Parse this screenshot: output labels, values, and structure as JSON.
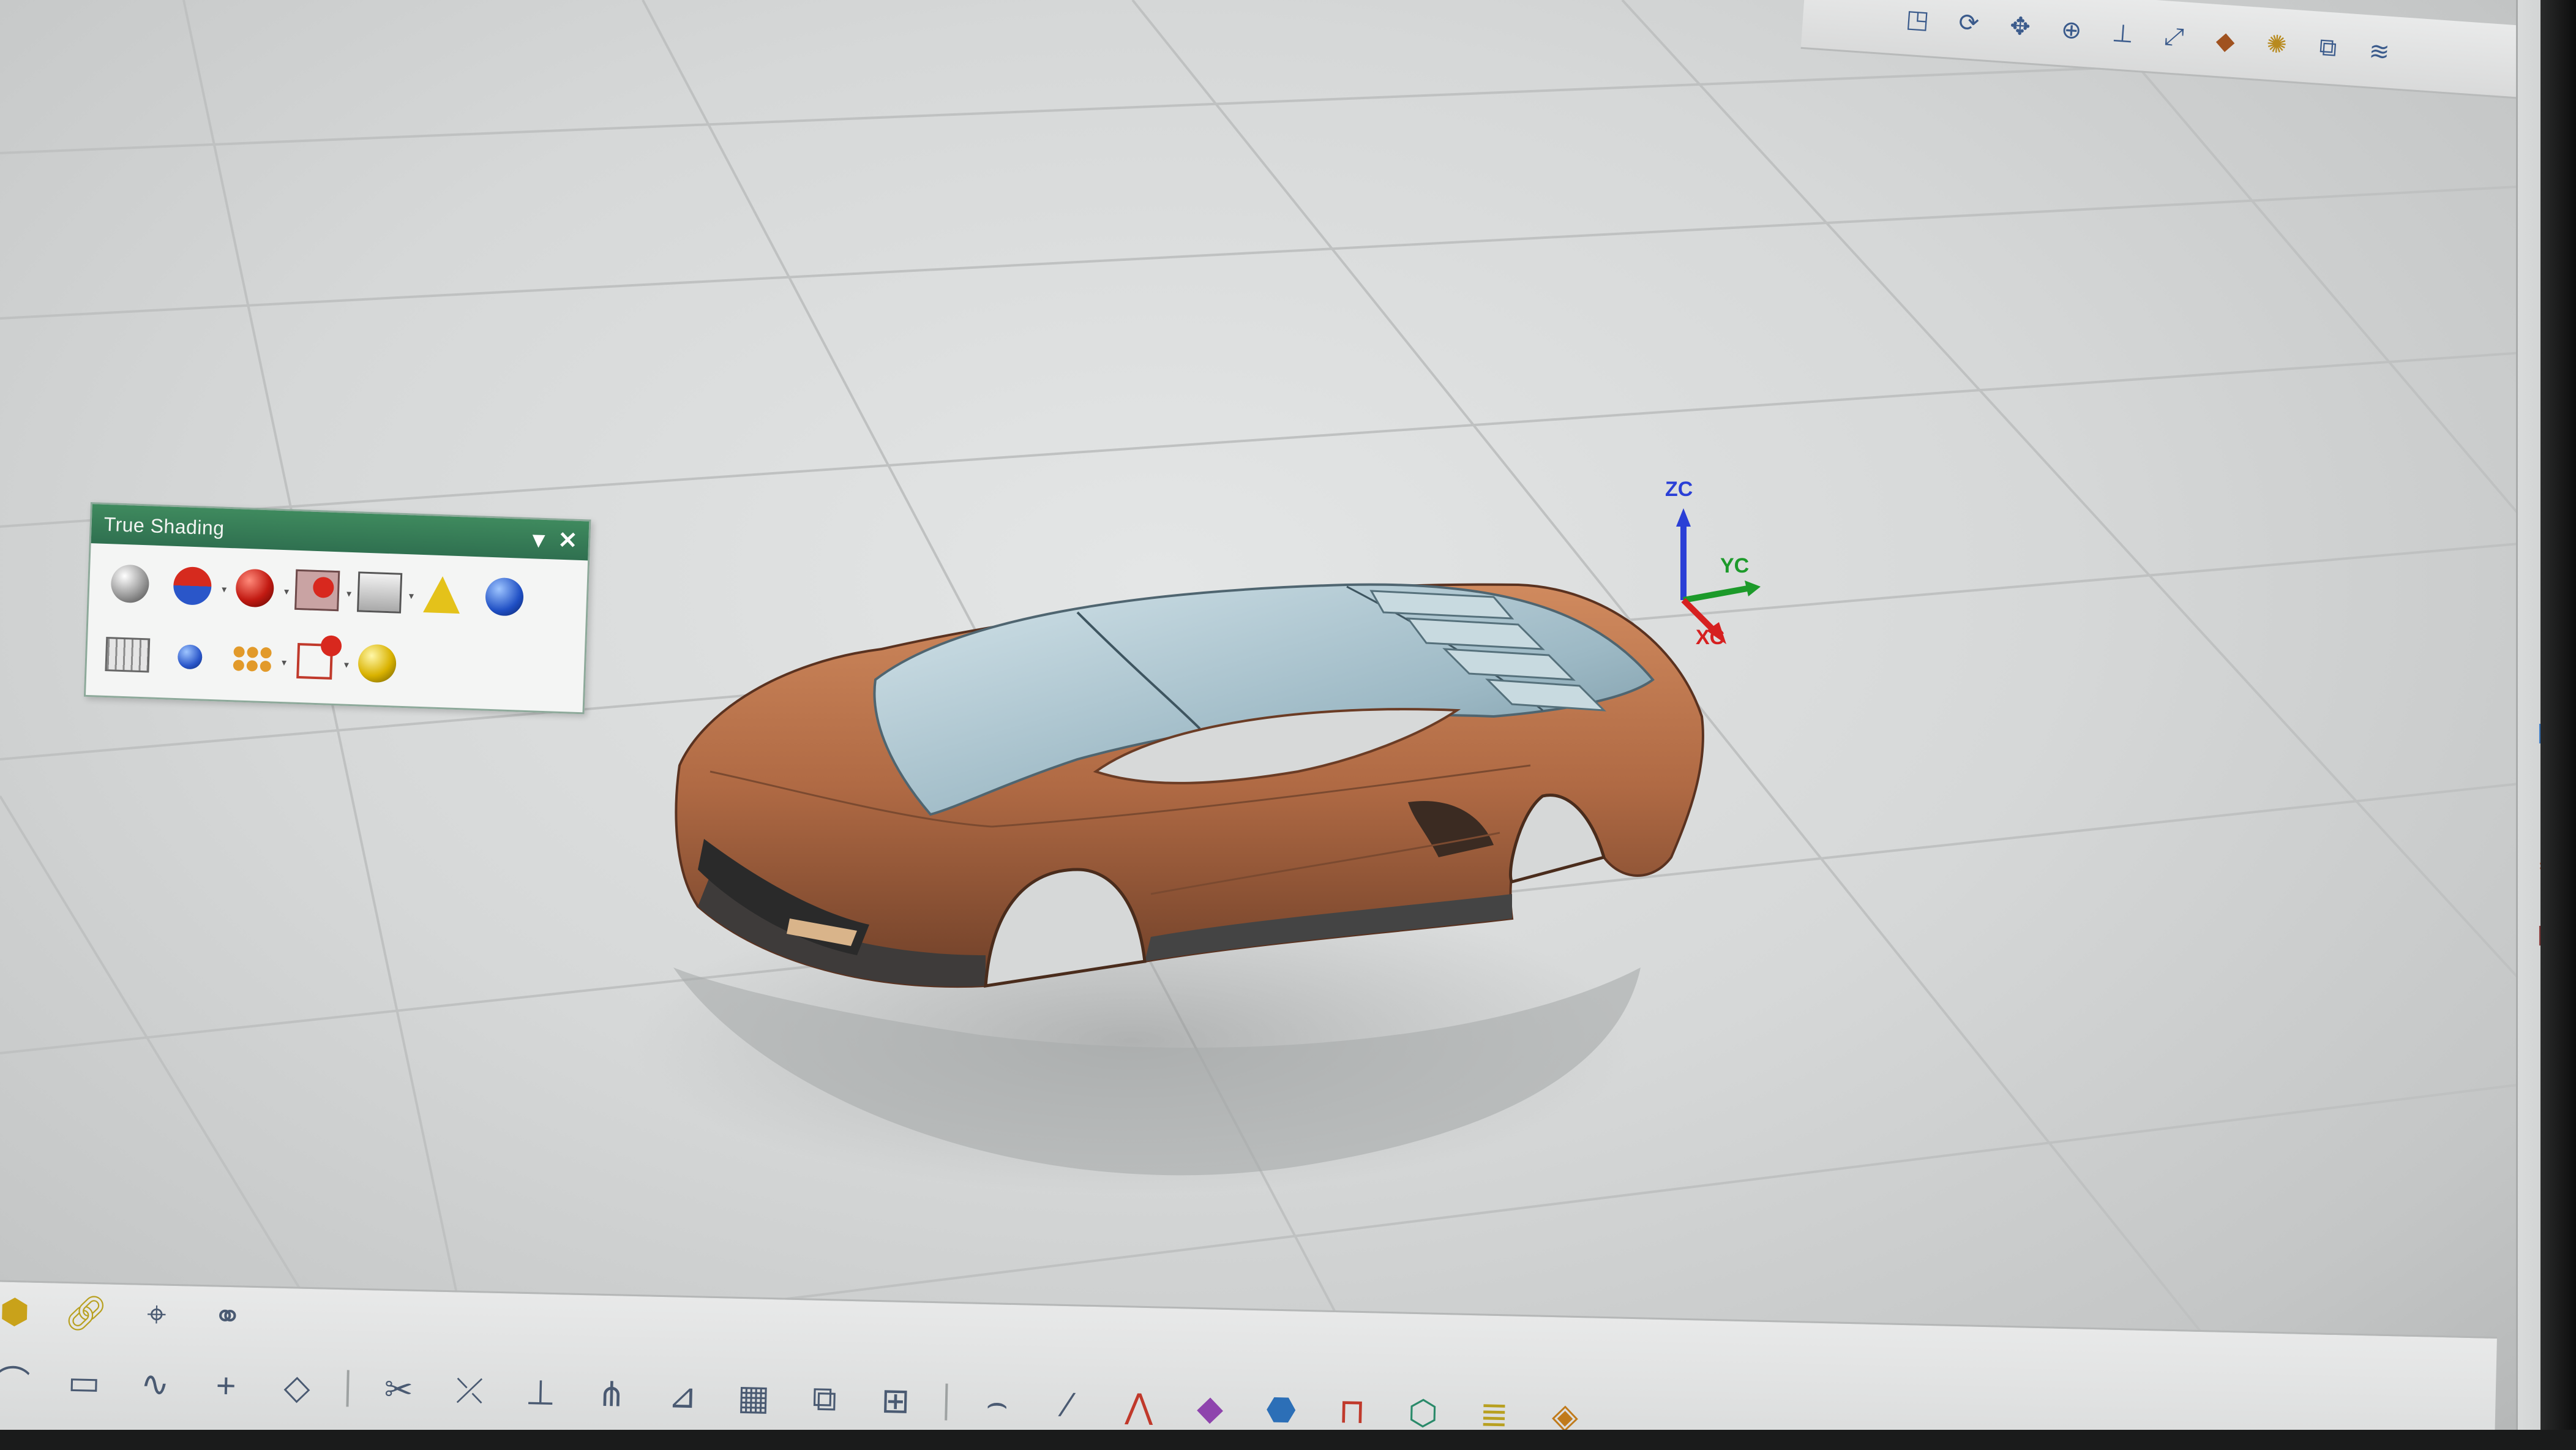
{
  "palette": {
    "title": "True Shading",
    "menu_glyph": "▾",
    "close_glyph": "✕",
    "row1": [
      "shaded-sphere-icon",
      "red-blue-sphere-icon",
      "red-sphere-icon",
      "texture-icon",
      "background-icon",
      "light-icon",
      "blue-sphere-icon"
    ],
    "row2": [
      "grid-plane-icon",
      "figure-icon",
      "cluster-icon",
      "cube-sphere-icon",
      "globe-icon"
    ]
  },
  "triad": {
    "z": "ZC",
    "y": "YC",
    "x": "XC"
  },
  "colors": {
    "palette_title": "#2f7050",
    "car_body": "#b8714a",
    "car_glass": "#a9c4cf",
    "axis_x": "#d62020",
    "axis_y": "#1c9a2a",
    "axis_z": "#2a3fd6"
  },
  "top_toolbar_icons": [
    "view-icon",
    "rotate-icon",
    "pan-icon",
    "zoom-icon",
    "wcs-icon",
    "fit-icon",
    "render-icon",
    "light-icon",
    "style-icon",
    "spring-icon"
  ],
  "bottom_toolbar_row1": [
    "feature-icon",
    "sketch-icon",
    "dimension-icon",
    "assembly-icon"
  ],
  "bottom_toolbar_row2": [
    "arc-icon",
    "rectangle-icon",
    "spline-icon",
    "point-icon",
    "plane-icon",
    "trim-icon",
    "extend-icon",
    "offset-icon",
    "mirror-icon",
    "project-icon",
    "table-icon",
    "pattern-icon",
    "join-icon",
    "curve-icon",
    "line-icon",
    "bridge-icon",
    "surface-icon",
    "sweep-icon",
    "shell-icon",
    "draft-icon",
    "analysis-icon",
    "layer-icon"
  ],
  "resource_bar_icons": [
    "history-icon",
    "roles-icon",
    "palette-icon",
    "assembly-navigator-icon",
    "web-icon"
  ]
}
